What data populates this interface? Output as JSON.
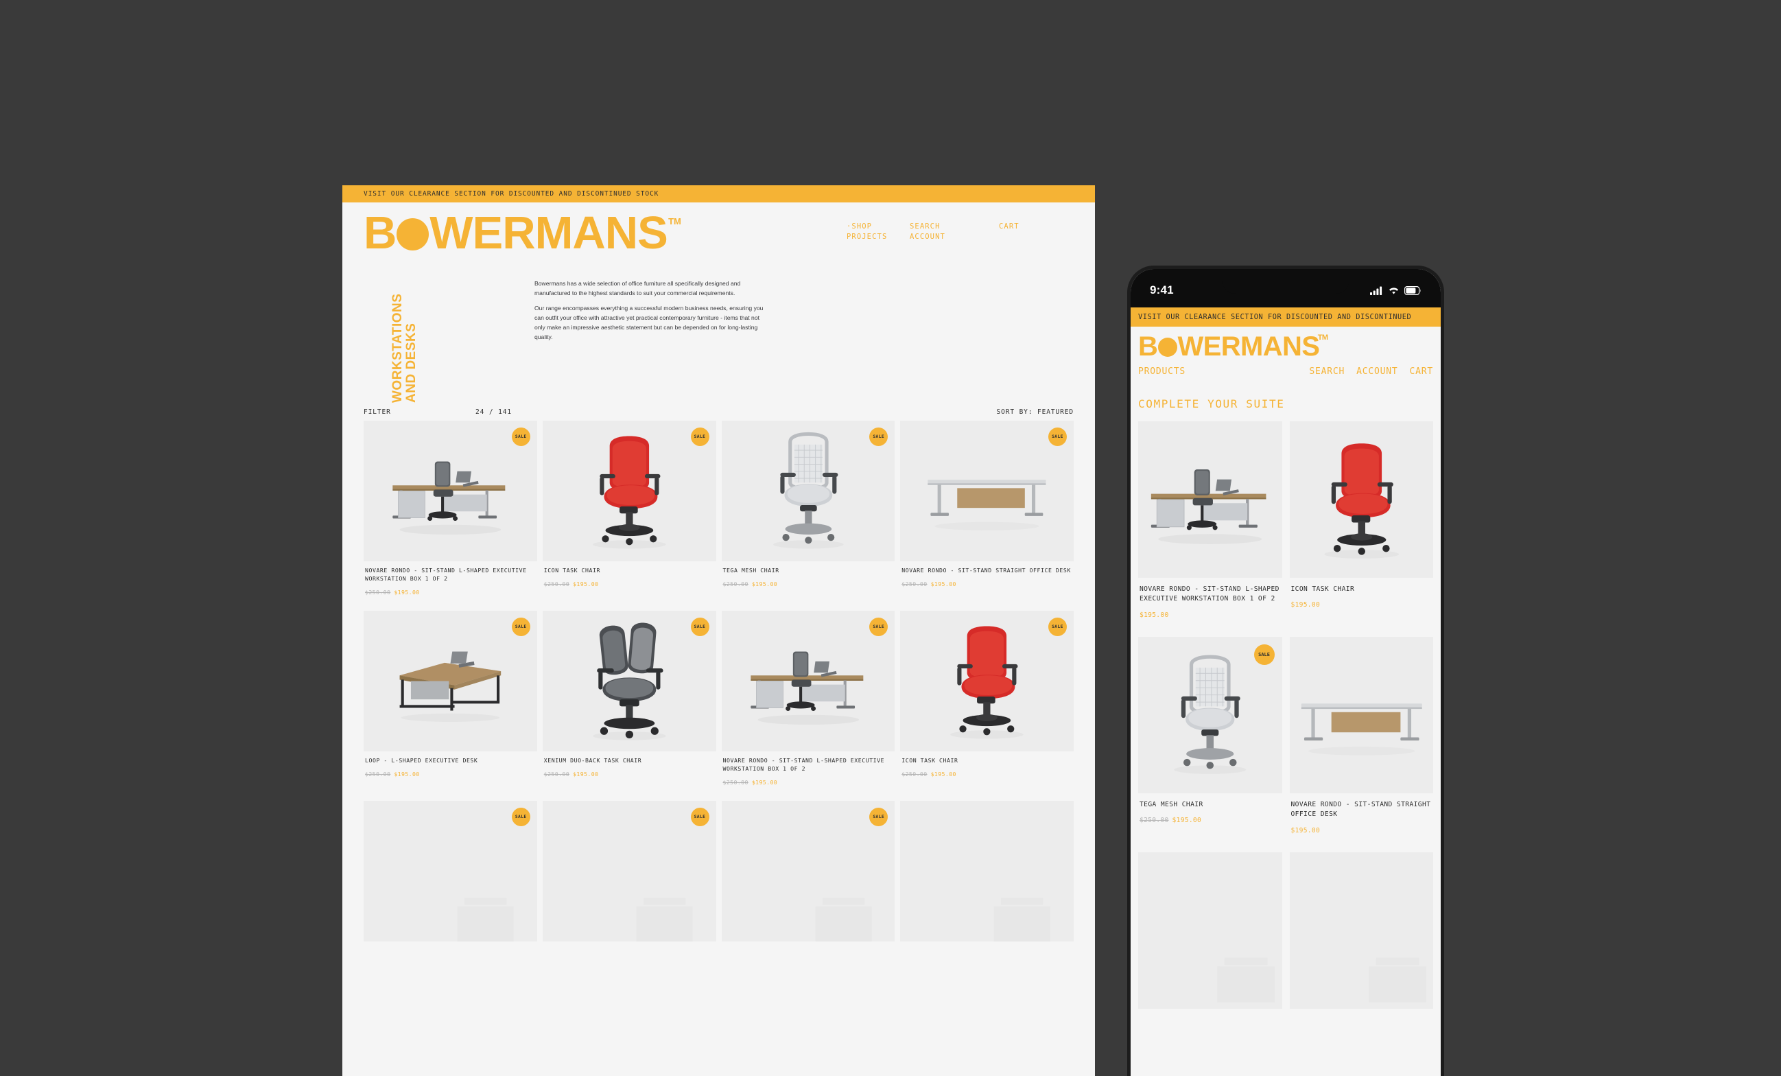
{
  "theme": {
    "brand_orange": "#f5b335",
    "page_bg": "#3a3a3a",
    "surface": "#f5f5f5",
    "image_bg": "#ececec",
    "text_dark": "#2e2e2e",
    "price_old": "#b4b4b4"
  },
  "desktop": {
    "promo_banner": "VISIT OUR CLEARANCE SECTION FOR DISCOUNTED AND DISCONTINUED STOCK",
    "logo": {
      "before_o": "B",
      "after_o": "WERMANS",
      "trademark": "TM"
    },
    "nav": {
      "col1": [
        "·SHOP",
        "PROJECTS"
      ],
      "col2": [
        "SEARCH",
        "ACCOUNT"
      ],
      "col3": [
        "CART"
      ]
    },
    "category_title_line1": "WORKSTATIONS",
    "category_title_line2": "AND DESKS",
    "intro_paragraph_1": "Bowermans has a wide selection of office furniture all specifically designed and manufactured to the highest standards to suit your commercial requirements.",
    "intro_paragraph_2": "Our range encompasses everything a successful modern business needs, ensuring you can outfit your office with attractive yet practical contemporary furniture - items that not only make an impressive aesthetic statement but can be depended on for long-lasting quality.",
    "toolbar": {
      "filter_label": "FILTER",
      "count_label": "24 / 141",
      "sort_label": "SORT BY: FEATURED"
    },
    "sale_badge_label": "SALE",
    "products": [
      {
        "title": "NOVARE RONDO - SIT-STAND L-SHAPED EXECUTIVE WORKSTATION BOX 1 OF 2",
        "price_old": "$250.00",
        "price_new": "$195.00",
        "on_sale": true,
        "art": "desk-workstation"
      },
      {
        "title": "ICON TASK CHAIR",
        "price_old": "$250.00",
        "price_new": "$195.00",
        "on_sale": true,
        "art": "red-chair"
      },
      {
        "title": "TEGA MESH CHAIR",
        "price_old": "$250.00",
        "price_new": "$195.00",
        "on_sale": true,
        "art": "mesh-chair"
      },
      {
        "title": "NOVARE RONDO - SIT-STAND STRAIGHT OFFICE DESK",
        "price_old": "$250.00",
        "price_new": "$195.00",
        "on_sale": true,
        "art": "straight-desk"
      },
      {
        "title": "LOOP - L-SHAPED EXECUTIVE DESK",
        "price_old": "$250.00",
        "price_new": "$195.00",
        "on_sale": true,
        "art": "loop-desk"
      },
      {
        "title": "XENIUM DUO-BACK TASK CHAIR",
        "price_old": "$250.00",
        "price_new": "$195.00",
        "on_sale": true,
        "art": "duoback-chair"
      },
      {
        "title": "NOVARE RONDO - SIT-STAND L-SHAPED EXECUTIVE WORKSTATION BOX 1 OF 2",
        "price_old": "$250.00",
        "price_new": "$195.00",
        "on_sale": true,
        "art": "desk-workstation"
      },
      {
        "title": "ICON TASK CHAIR",
        "price_old": "$250.00",
        "price_new": "$195.00",
        "on_sale": true,
        "art": "red-chair"
      },
      {
        "title": "",
        "price_old": "",
        "price_new": "",
        "on_sale": true,
        "art": "blank"
      },
      {
        "title": "",
        "price_old": "",
        "price_new": "",
        "on_sale": true,
        "art": "blank"
      },
      {
        "title": "",
        "price_old": "",
        "price_new": "",
        "on_sale": true,
        "art": "blank"
      },
      {
        "title": "",
        "price_old": "",
        "price_new": "",
        "on_sale": false,
        "art": "blank"
      }
    ]
  },
  "mobile": {
    "status_bar": {
      "time": "9:41",
      "cellular": "signal-bars",
      "wifi": "wifi",
      "battery": "battery"
    },
    "promo_banner": "VISIT OUR CLEARANCE SECTION FOR DISCOUNTED AND DISCONTINUED",
    "logo": {
      "before_o": "B",
      "after_o": "WERMANS",
      "trademark": "TM"
    },
    "nav": [
      "PRODUCTS",
      "SEARCH",
      "ACCOUNT",
      "CART"
    ],
    "section_title": "COMPLETE YOUR SUITE",
    "sale_badge_label": "SALE",
    "products": [
      {
        "title": "NOVARE RONDO - SIT-STAND L-SHAPED EXECUTIVE WORKSTATION BOX 1 OF 2",
        "price_old": "",
        "price_new": "$195.00",
        "on_sale": false,
        "art": "desk-workstation"
      },
      {
        "title": "ICON TASK CHAIR",
        "price_old": "",
        "price_new": "$195.00",
        "on_sale": false,
        "art": "red-chair"
      },
      {
        "title": "TEGA MESH CHAIR",
        "price_old": "$250.00",
        "price_new": "$195.00",
        "on_sale": true,
        "art": "mesh-chair"
      },
      {
        "title": "NOVARE RONDO - SIT-STAND STRAIGHT OFFICE DESK",
        "price_old": "",
        "price_new": "$195.00",
        "on_sale": false,
        "art": "straight-desk"
      },
      {
        "title": "",
        "price_old": "",
        "price_new": "",
        "on_sale": false,
        "art": "blank"
      },
      {
        "title": "",
        "price_old": "",
        "price_new": "",
        "on_sale": false,
        "art": "blank"
      }
    ]
  }
}
